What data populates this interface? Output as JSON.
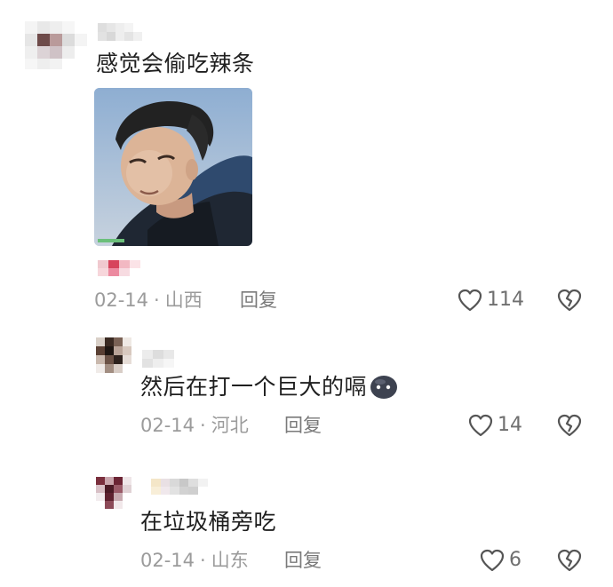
{
  "comments": [
    {
      "text": "感觉会偷吃辣条",
      "date": "02-14",
      "location": "山西",
      "reply_label": "回复",
      "likes": "114"
    },
    {
      "text": "然后在打一个巨大的嗝",
      "date": "02-14",
      "location": "河北",
      "reply_label": "回复",
      "likes": "14"
    },
    {
      "text": "在垃圾桶旁吃",
      "date": "02-14",
      "location": "山东",
      "reply_label": "回复",
      "likes": "6"
    }
  ],
  "separator": "·",
  "icons": {
    "like": "heart-outline-icon",
    "dislike": "broken-heart-icon",
    "emoji": "dark-blob-emoji-icon"
  },
  "colors": {
    "text": "#1f1f1f",
    "meta": "#9b9b9b",
    "icon": "#555555",
    "background": "#ffffff"
  }
}
